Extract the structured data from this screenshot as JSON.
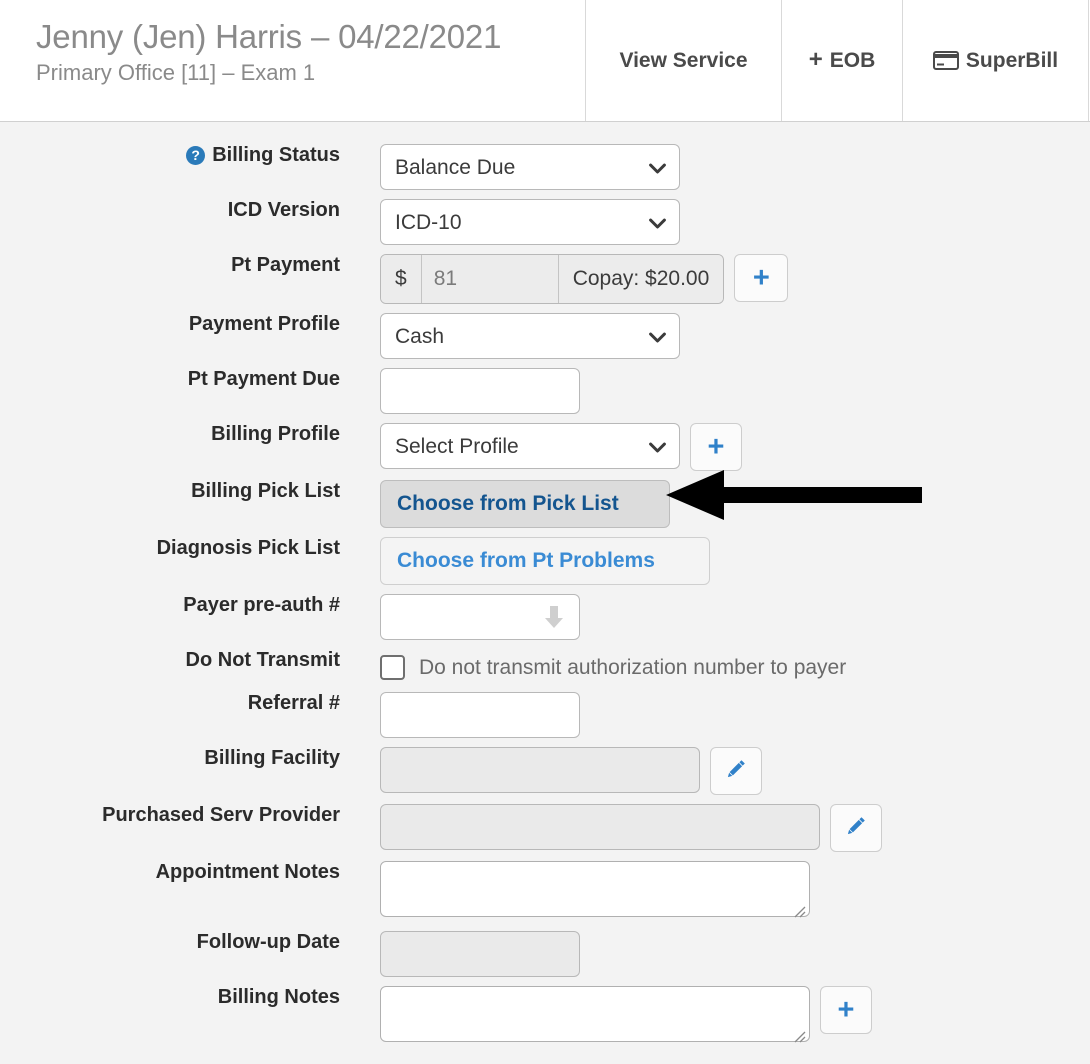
{
  "header": {
    "patient_name_and_date": "Jenny (Jen) Harris – 04/22/2021",
    "location": "Primary Office [11] – Exam 1",
    "tabs": [
      {
        "label": "View Service",
        "icon": ""
      },
      {
        "label": "EOB",
        "icon": "plus-icon"
      },
      {
        "label": "SuperBill",
        "icon": "credit-card-icon"
      }
    ],
    "eob_plus": "+"
  },
  "form": {
    "billing_status": {
      "label": "Billing Status",
      "help_icon_glyph": "?",
      "value": "Balance Due"
    },
    "icd_version": {
      "label": "ICD Version",
      "value": "ICD-10"
    },
    "pt_payment": {
      "label": "Pt Payment",
      "currency_symbol": "$",
      "amount_placeholder": "81",
      "amount_value": "",
      "copay_text": "Copay: $20.00",
      "add_label": "+"
    },
    "payment_profile": {
      "label": "Payment Profile",
      "value": "Cash"
    },
    "pt_payment_due": {
      "label": "Pt Payment Due",
      "value": ""
    },
    "billing_profile": {
      "label": "Billing Profile",
      "value": "Select Profile",
      "add_label": "+"
    },
    "billing_pick_list": {
      "label": "Billing Pick List",
      "button_label": "Choose from Pick List"
    },
    "diagnosis_pick_list": {
      "label": "Diagnosis Pick List",
      "button_label": "Choose from Pt Problems"
    },
    "payer_preauth": {
      "label": "Payer pre-auth #",
      "value": ""
    },
    "do_not_transmit": {
      "label": "Do Not Transmit",
      "checkbox_label": "Do not transmit authorization number to payer",
      "checked": false
    },
    "referral_number": {
      "label": "Referral #",
      "value": ""
    },
    "billing_facility": {
      "label": "Billing Facility",
      "value": ""
    },
    "purchased_serv_provider": {
      "label": "Purchased Serv Provider",
      "value": ""
    },
    "appointment_notes": {
      "label": "Appointment Notes",
      "value": ""
    },
    "followup_date": {
      "label": "Follow-up Date",
      "value": ""
    },
    "billing_notes": {
      "label": "Billing Notes",
      "value": "",
      "add_label": "+"
    }
  },
  "annotation": {
    "arrow": "left-pointing-arrow"
  },
  "colors": {
    "accent_blue": "#3081c9",
    "link_blue": "#3a8bd4",
    "active_link_blue": "#14558f",
    "help_icon_blue": "#2a7ab9",
    "page_bg": "#f3f3f3",
    "header_bg": "#ffffff",
    "label_text": "#2b2b2b",
    "muted_text": "#8a8a8a"
  }
}
